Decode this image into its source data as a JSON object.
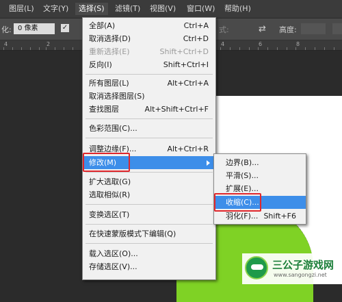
{
  "menubar": {
    "items": [
      {
        "label": "图层(L)"
      },
      {
        "label": "文字(Y)"
      },
      {
        "label": "选择(S)"
      },
      {
        "label": "滤镜(T)"
      },
      {
        "label": "视图(V)"
      },
      {
        "label": "窗口(W)"
      },
      {
        "label": "帮助(H)"
      }
    ]
  },
  "options": {
    "feather_label": "化:",
    "feather_value": "0 像素",
    "style_label": "式:",
    "height_label": "高度:"
  },
  "ruler": {
    "labels": [
      "4",
      "2",
      "4",
      "6",
      "8"
    ]
  },
  "select_menu": {
    "items": [
      {
        "label": "全部(A)",
        "shortcut": "Ctrl+A"
      },
      {
        "label": "取消选择(D)",
        "shortcut": "Ctrl+D"
      },
      {
        "label": "重新选择(E)",
        "shortcut": "Shift+Ctrl+D"
      },
      {
        "label": "反向(I)",
        "shortcut": "Shift+Ctrl+I"
      },
      {
        "label": "所有图层(L)",
        "shortcut": "Alt+Ctrl+A"
      },
      {
        "label": "取消选择图层(S)",
        "shortcut": ""
      },
      {
        "label": "查找图层",
        "shortcut": "Alt+Shift+Ctrl+F"
      },
      {
        "label": "色彩范围(C)...",
        "shortcut": ""
      },
      {
        "label": "调整边缘(F)...",
        "shortcut": "Alt+Ctrl+R"
      },
      {
        "label": "修改(M)",
        "shortcut": ""
      },
      {
        "label": "扩大选取(G)",
        "shortcut": ""
      },
      {
        "label": "选取相似(R)",
        "shortcut": ""
      },
      {
        "label": "变换选区(T)",
        "shortcut": ""
      },
      {
        "label": "在快速蒙版模式下编辑(Q)",
        "shortcut": ""
      },
      {
        "label": "载入选区(O)...",
        "shortcut": ""
      },
      {
        "label": "存储选区(V)...",
        "shortcut": ""
      }
    ]
  },
  "modify_submenu": {
    "items": [
      {
        "label": "边界(B)...",
        "shortcut": ""
      },
      {
        "label": "平滑(S)...",
        "shortcut": ""
      },
      {
        "label": "扩展(E)...",
        "shortcut": ""
      },
      {
        "label": "收缩(C)...",
        "shortcut": ""
      },
      {
        "label": "羽化(F)...",
        "shortcut": "Shift+F6"
      }
    ]
  },
  "watermark": {
    "title": "三公子游戏网",
    "url": "www.sangongzi.net"
  },
  "colors": {
    "highlight": "#3d8ee9",
    "annotation": "#e0262b",
    "selection_fill": "#7fd225"
  }
}
